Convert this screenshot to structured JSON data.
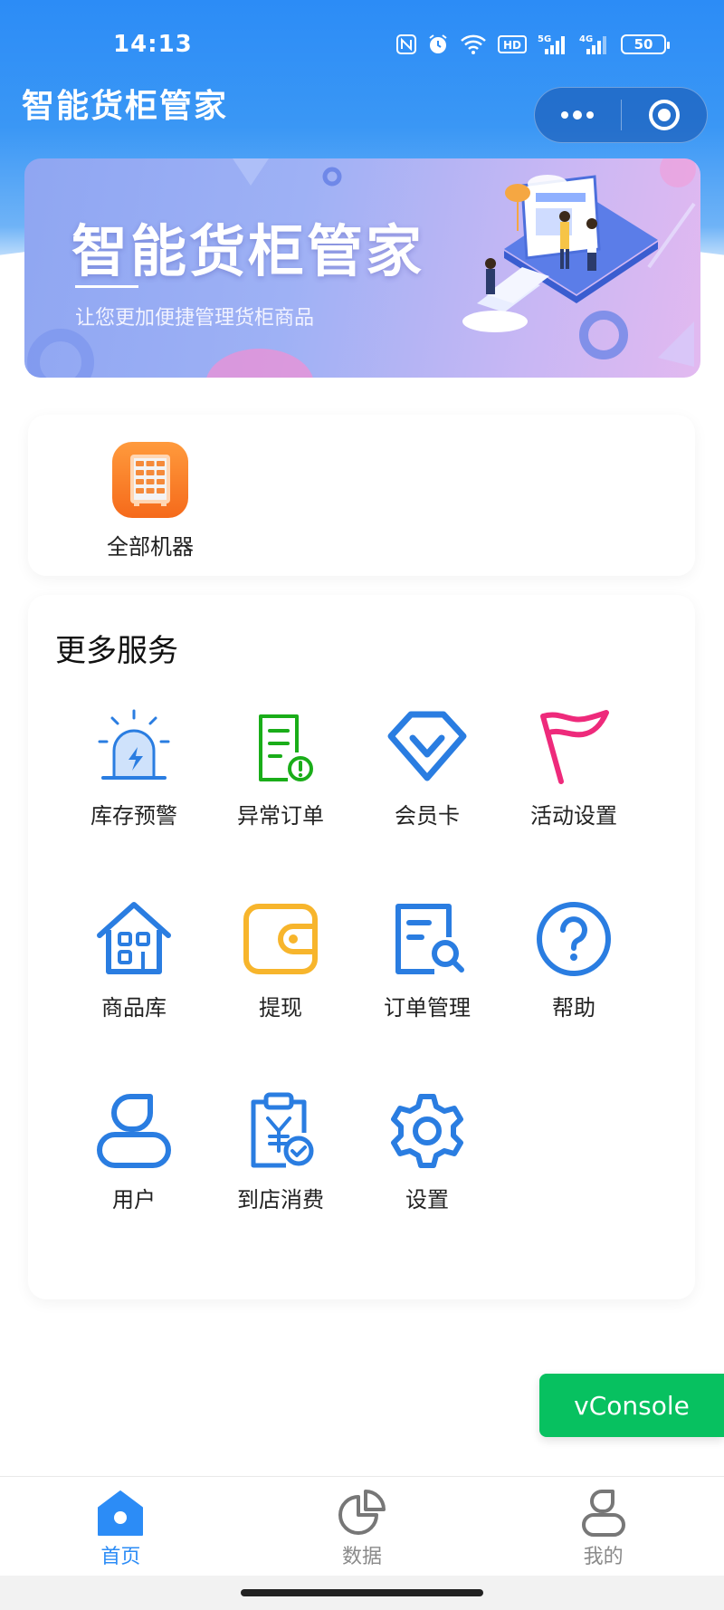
{
  "status_bar": {
    "time": "14:13",
    "battery": "50",
    "network_5g": "5G",
    "network_4g": "4G",
    "hd_label": "HD"
  },
  "header": {
    "app_title": "智能货柜管家"
  },
  "banner": {
    "title": "智能货柜管家",
    "subtitle": "让您更加便捷管理货柜商品"
  },
  "machines": {
    "items": [
      {
        "label": "全部机器",
        "icon": "vending-cabinet-icon"
      }
    ]
  },
  "services": {
    "title": "更多服务",
    "items": [
      {
        "label": "库存预警",
        "icon": "alarm-light-icon"
      },
      {
        "label": "异常订单",
        "icon": "document-warning-icon"
      },
      {
        "label": "会员卡",
        "icon": "member-badge-icon"
      },
      {
        "label": "活动设置",
        "icon": "flag-icon"
      },
      {
        "label": "商品库",
        "icon": "house-grid-icon"
      },
      {
        "label": "提现",
        "icon": "wallet-icon"
      },
      {
        "label": "订单管理",
        "icon": "document-search-icon"
      },
      {
        "label": "帮助",
        "icon": "help-circle-icon"
      },
      {
        "label": "用户",
        "icon": "user-icon"
      },
      {
        "label": "到店消费",
        "icon": "clipboard-yen-icon"
      },
      {
        "label": "设置",
        "icon": "gear-icon"
      }
    ]
  },
  "vconsole": {
    "label": "vConsole"
  },
  "tabbar": {
    "items": [
      {
        "label": "首页",
        "icon": "home-icon",
        "active": true
      },
      {
        "label": "数据",
        "icon": "pie-chart-icon",
        "active": false
      },
      {
        "label": "我的",
        "icon": "profile-icon",
        "active": false
      }
    ]
  },
  "colors": {
    "primary": "#2c8cf6",
    "service_blue": "#2a7de1",
    "service_green": "#1aad19",
    "service_pink": "#ee2a7b",
    "service_yellow": "#f7b52c",
    "machine_orange": "#f57c24",
    "vconsole_green": "#07c160"
  }
}
